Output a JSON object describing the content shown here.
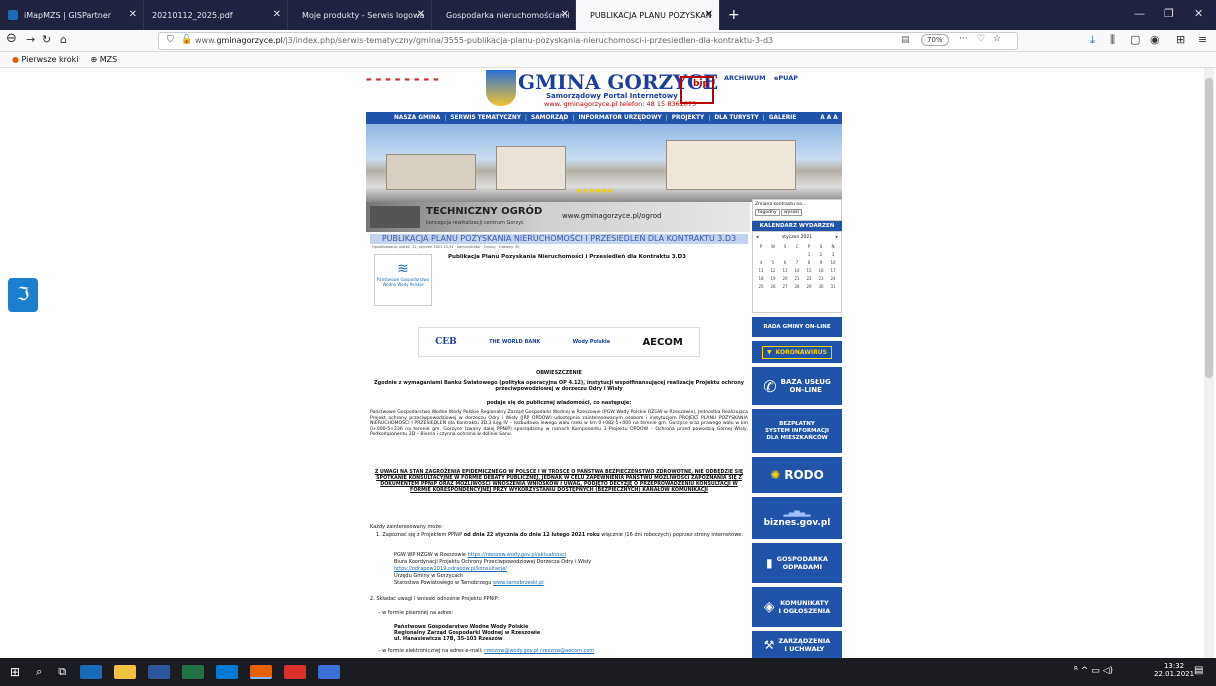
{
  "browser": {
    "tabs": [
      {
        "label": "iMapMZS | GISPartner",
        "color": "#1b6ab5"
      },
      {
        "label": "20210112_2025.pdf",
        "color": "#888888"
      },
      {
        "label": "Moje produkty - Serwis logowa",
        "color": "#4caf50"
      },
      {
        "label": "Gospodarka nieruchomościami",
        "color": "#4caf50"
      },
      {
        "label": "PUBLIKACJA PLANU POZYSKAN",
        "color": "#1f54a8"
      }
    ],
    "new_tab": "+",
    "url_prefix": "www.",
    "url_domain": "gminagorzyce.pl",
    "url_path": "/j3/index.php/serwis-tematyczny/gmina/3555-publikacja-planu-pozyskania-nieruchomosci-i-przesiedlen-dla-kontraktu-3-d3",
    "zoom": "70%",
    "bookmarks": [
      "Pierwsze kroki",
      "MZS"
    ]
  },
  "site": {
    "brand": "GMINA GORZYCE",
    "sub": "Samorządowy Portal Internetowy",
    "sub2": "www. gminagorzyce.pl  telefon: 48 15 8362075",
    "bip": "bip",
    "archiwum": "ARCHIWUM",
    "epuap": "ePUAP",
    "menu": [
      "NASZA GMINA",
      "SERWIS TEMATYCZNY",
      "SAMORZĄD",
      "INFORMATOR URZĘDOWY",
      "PROJEKTY",
      "DLA TURYSTY",
      "GALERIE"
    ],
    "tech_title": "TECHNICZNY OGRÓD",
    "tech_sub": "koncepcja rewitalizacji centrum Gorzyc",
    "tech_url": "www.gminagorzyce.pl/ogrod"
  },
  "article": {
    "title": "PUBLIKACJA PLANU POZYSKANIA NIERUCHOMOŚCI I PRZESIEDLEŃ DLA KONTRAKTU 3.D3",
    "meta": "Opublikowano: piątek, 22, styczeń 2021 10:34 · Administrator · Drukuj · Odsłony: 30",
    "pub": "Publikacja Planu Pozyskania Nieruchomości i Przesiedleń dla Kontraktu 3.D3",
    "pgw": "Państwowe Gospodarstwo Wodne Wody Polskie",
    "logos": [
      "CEB",
      "THE WORLD BANK",
      "Wody Polskie",
      "AECOM"
    ],
    "obw": "OBWIESZCZENIE",
    "p1": "Zgodnie z wymaganiami Banku Światowego (polityka operacyjna OP 4.12), instytucji współfinansującej realizację Projektu ochrony przeciwpowodziowej w dorzeczu Odry i Wisły",
    "p2": "podaje się do publicznej wiadomości, co następuje:",
    "p3": "Państwowe Gospodarstwo Wodne Wody Polskie Regionalny Zarząd Gospodarki Wodnej w Rzeszowie (PGW Wody Polskie RZGW w Rzeszowie), Jednostka Realizująca Projekt ochrony przeciwpowodziowej w dorzeczu Odry i Wisły (JRP OPDOW) udostępnia zainteresowanym osobom i instytucjom PROJEKT PLANU POZYSKANIA NIERUCHOMOŚCI I PRZESIEDLEŃ dla Kontraktu 3D.3 Łęg IV – rozbudowa lewego wału rzeki w km 0+082-5+000 na terenie gm. Gorzyce oraz prawego wału w km 0+000-5+236 na terenie gm. Gorzyce (zwany dalej PPNiP) sporządzony w ramach Komponentu 3 Projektu OPDOW – Ochrona przed powodzią Górnej Wisły, Podkomponentu 3D – Bierna i czynna ochrona w dolinie Sanu.",
    "p4": "Z UWAGI NA STAN ZAGROŻENIA EPIDEMICZNEGO W POLSCE I W TROSCE O PAŃSTWA BEZPIECZEŃSTWO ZDROWOTNE, NIE ODBĘDZIE SIĘ SPOTKANIE KONSULTACYJNE W FORMIE DEBATY PUBLICZNEJ, JEDNAK W CELU ZAPEWNIENIA PAŃSTWU MOŻLIWOŚCI ZAPOZNANIA SIĘ Z DOKUMENTEM PPNiP ORAZ MOŻLIWOŚCI WNOSZENIA WNIOSKÓW I UWAG, PODJĘTO DECYZJĘ O PRZEPROWADZENIU KONSULTACJI W FORMIE KORESPONDENCYJNEJ PRZY WYKORZYSTANIU DOSTĘPNYCH (BEZPIECZNYCH) KANAŁÓW KOMUNIKACJI",
    "p5": "Każdy zainteresowany może:",
    "p6a": "1. Zapoznać się z Projektem PPNiP ",
    "p6b": "od dnia 22 stycznia do dnia 12 lutego 2021 roku",
    "p6c": " włącznie (16 dni roboczych) poprzez strony internetowe:",
    "l1": "PGW WP RZGW w Rzeszowie",
    "l1url": "https://rzeszow.wody.gov.pl/aktualnosci",
    "l2": "Biura Koordynacji Projektu Ochrony Przeciwpowodziowej Dorzecza Odry i Wisły",
    "l2url": "https://odrapow2019.odrapow.pl/konsultacje/",
    "l3": "Urzędu Gminy w Gorzycach",
    "l4": "Starostwa Powiatowego w Tarnobrzegu",
    "l4url": "www.tarnobrzeski.pl",
    "p7": "2. Składać uwagi i wnioski odnośnie Projektu PPNiP:",
    "p8": "– w formie pisemnej na adres:",
    "addr1": "Państwowe Gospodarstwo Wodne Wody Polskie",
    "addr2": "Regionalny Zarząd Gospodarki Wodnej w Rzeszowie",
    "addr3": "ul. Hanasiewicza 17B, 35-103 Rzeszów",
    "p9a": "– w formie elektronicznej na adres e-mail: ",
    "p9b": "rzeszow@wody.gov.pl",
    "p9c": " rzeszow@aecom.com"
  },
  "side": {
    "ctrl1": "Zmiana kontrastu na...",
    "ctrl2": "tagodny",
    "ctrl3": "wysoki",
    "cal_h": "KALENDARZ WYDARZEŃ",
    "month": "styczeń 2021",
    "days": [
      "P",
      "W",
      "Ś",
      "C",
      "P",
      "S",
      "N",
      "",
      "",
      "",
      "",
      "1",
      "2",
      "3",
      "4",
      "5",
      "6",
      "7",
      "8",
      "9",
      "10",
      "11",
      "12",
      "13",
      "14",
      "15",
      "16",
      "17",
      "18",
      "19",
      "20",
      "21",
      "22",
      "23",
      "24",
      "25",
      "26",
      "27",
      "28",
      "29",
      "30",
      "31"
    ],
    "rada": "RADA GMINY ON-LINE",
    "korona": "KORONAWIRUS",
    "baza1": "BAZA USŁUG",
    "baza2": "ON-LINE",
    "bezp1": "BEZPŁATNY",
    "bezp2": "SYSTEM INFORMACJI",
    "bezp3": "DLA MIESZKAŃCÓW",
    "rodo": "RODO",
    "biznes": "biznes.gov.pl",
    "gosp1": "GOSPODARKA",
    "gosp2": "ODPADAMI",
    "kom1": "KOMUNIKATY",
    "kom2": "I OGŁOSZENIA",
    "zarz1": "ZARZĄDZENIA",
    "zarz2": "I UCHWAŁY"
  },
  "taskbar": {
    "time": "13:32",
    "date": "22.01.2021"
  }
}
